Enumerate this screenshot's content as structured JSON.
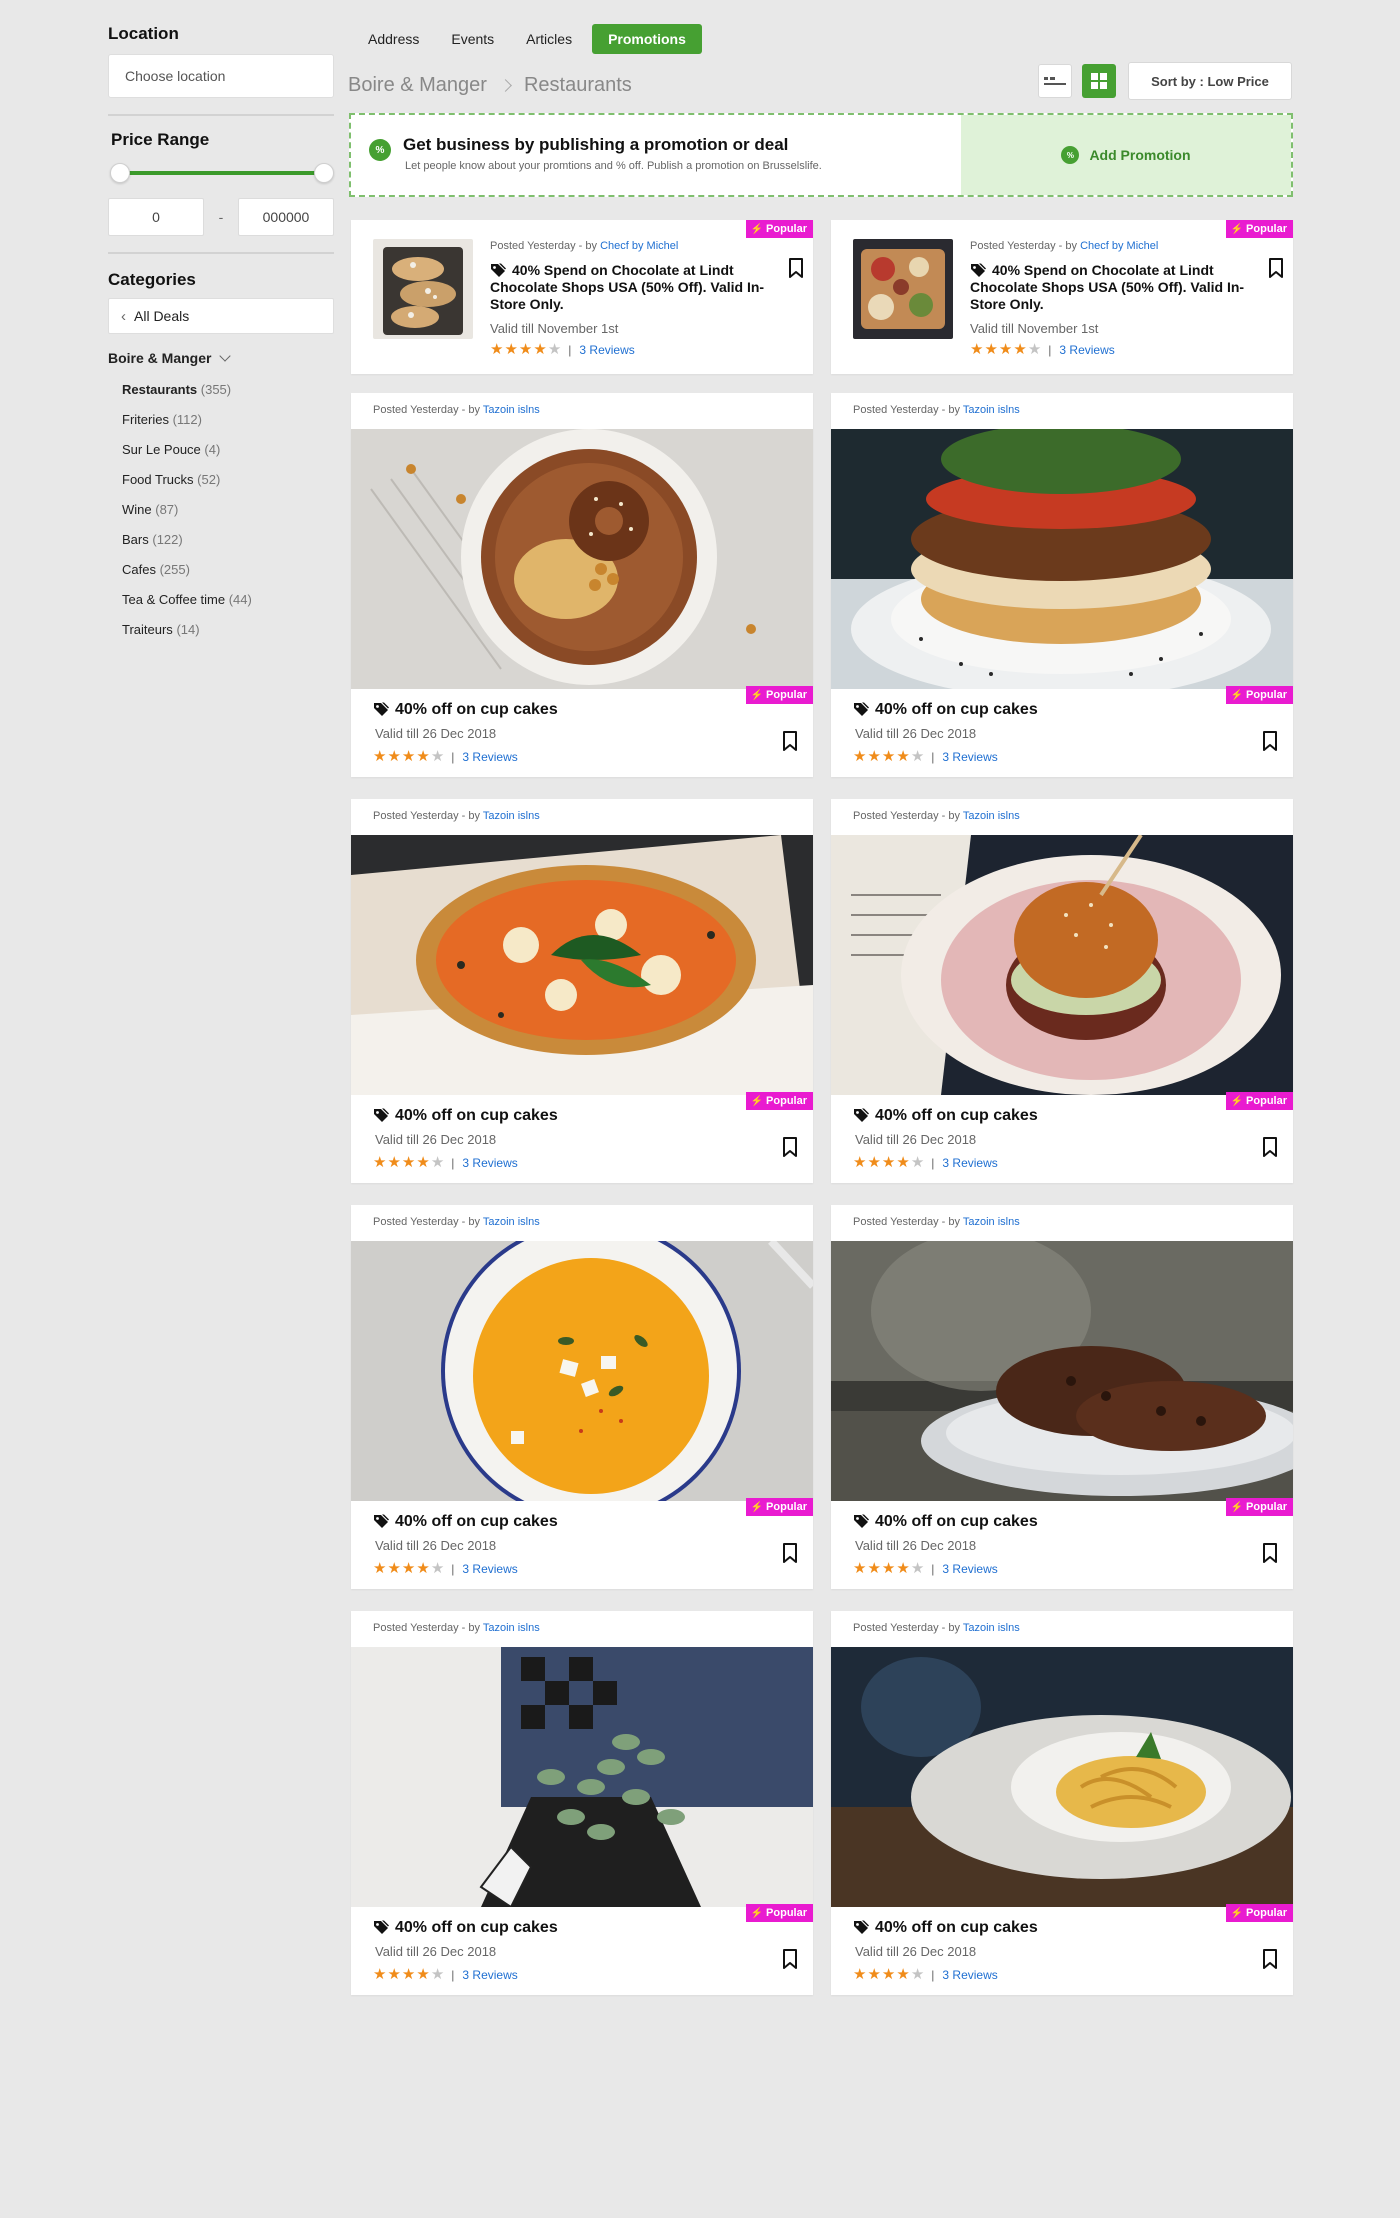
{
  "sidebar": {
    "location_heading": "Location",
    "location_placeholder": "Choose location",
    "price_heading": "Price Range",
    "price_min": "0",
    "price_max": "000000",
    "price_sep": "-",
    "categories_heading": "Categories",
    "all_deals": "All Deals",
    "group": "Boire & Manger",
    "items": [
      {
        "label": "Restaurants",
        "count": "(355)"
      },
      {
        "label": "Friteries",
        "count": "(112)"
      },
      {
        "label": "Sur Le Pouce",
        "count": "(4)"
      },
      {
        "label": "Food Trucks",
        "count": "(52)"
      },
      {
        "label": "Wine",
        "count": "(87)"
      },
      {
        "label": "Bars",
        "count": "(122)"
      },
      {
        "label": "Cafes",
        "count": "(255)"
      },
      {
        "label": "Tea & Coffee time",
        "count": "(44)"
      },
      {
        "label": "Traiteurs",
        "count": "(14)"
      }
    ]
  },
  "nav": {
    "tabs": [
      "Address",
      "Events",
      "Articles",
      "Promotions"
    ],
    "active_tab": "Promotions"
  },
  "breadcrumb": [
    "Boire & Manger",
    "Restaurants"
  ],
  "sort_label": "Sort by : Low Price",
  "banner": {
    "badge": "%",
    "title": "Get business by publishing a promotion or deal",
    "subtitle": "Let people know about your promtions and % off. Publish a promotion on Brusselslife.",
    "cta": "Add Promotion"
  },
  "popular_label": "Popular",
  "small_deals": [
    {
      "posted": "Posted Yesterday - by ",
      "author": "Checf by Michel",
      "title": "40% Spend on Chocolate at Lindt Chocolate Shops USA (50% Off). Valid In-Store Only.",
      "valid": "Valid till November 1st",
      "stars": 4,
      "reviews": "3 Reviews",
      "image": "pastry"
    },
    {
      "posted": "Posted Yesterday - by ",
      "author": "Checf by Michel",
      "title": "40% Spend on Chocolate at Lindt Chocolate Shops USA (50% Off). Valid In-Store Only.",
      "valid": "Valid till November 1st",
      "stars": 4,
      "reviews": "3 Reviews",
      "image": "platter"
    }
  ],
  "deals": [
    {
      "posted": "Posted Yesterday - by ",
      "author": "Tazoin islns",
      "title": "40% off on cup cakes",
      "valid": "Valid till  26 Dec 2018",
      "stars": 4,
      "reviews": "3 Reviews",
      "image": "bagel-bowl"
    },
    {
      "posted": "Posted Yesterday - by ",
      "author": "Tazoin islns",
      "title": "40% off on cup cakes",
      "valid": "Valid till  26 Dec 2018",
      "stars": 4,
      "reviews": "3 Reviews",
      "image": "burger-plate"
    },
    {
      "posted": "Posted Yesterday - by ",
      "author": "Tazoin islns",
      "title": "40% off on cup cakes",
      "valid": "Valid till  26 Dec 2018",
      "stars": 4,
      "reviews": "3 Reviews",
      "image": "pizza"
    },
    {
      "posted": "Posted Yesterday - by ",
      "author": "Tazoin islns",
      "title": "40% off on cup cakes",
      "valid": "Valid till  26 Dec 2018",
      "stars": 4,
      "reviews": "3 Reviews",
      "image": "burger-basket"
    },
    {
      "posted": "Posted Yesterday - by ",
      "author": "Tazoin islns",
      "title": "40% off on cup cakes",
      "valid": "Valid till  26 Dec 2018",
      "stars": 4,
      "reviews": "3 Reviews",
      "image": "soup"
    },
    {
      "posted": "Posted Yesterday - by ",
      "author": "Tazoin islns",
      "title": "40% off on cup cakes",
      "valid": "Valid till  26 Dec 2018",
      "stars": 4,
      "reviews": "3 Reviews",
      "image": "cookies"
    },
    {
      "posted": "Posted Yesterday - by ",
      "author": "Tazoin islns",
      "title": "40% off on cup cakes",
      "valid": "Valid till  26 Dec 2018",
      "stars": 4,
      "reviews": "3 Reviews",
      "image": "plant"
    },
    {
      "posted": "Posted Yesterday - by ",
      "author": "Tazoin islns",
      "title": "40% off on cup cakes",
      "valid": "Valid till  26 Dec 2018",
      "stars": 4,
      "reviews": "3 Reviews",
      "image": "pasta"
    }
  ],
  "colors": {
    "accent": "#46a032",
    "popular": "#e91bd0",
    "star": "#f08c1a",
    "link": "#1f6fd1"
  }
}
